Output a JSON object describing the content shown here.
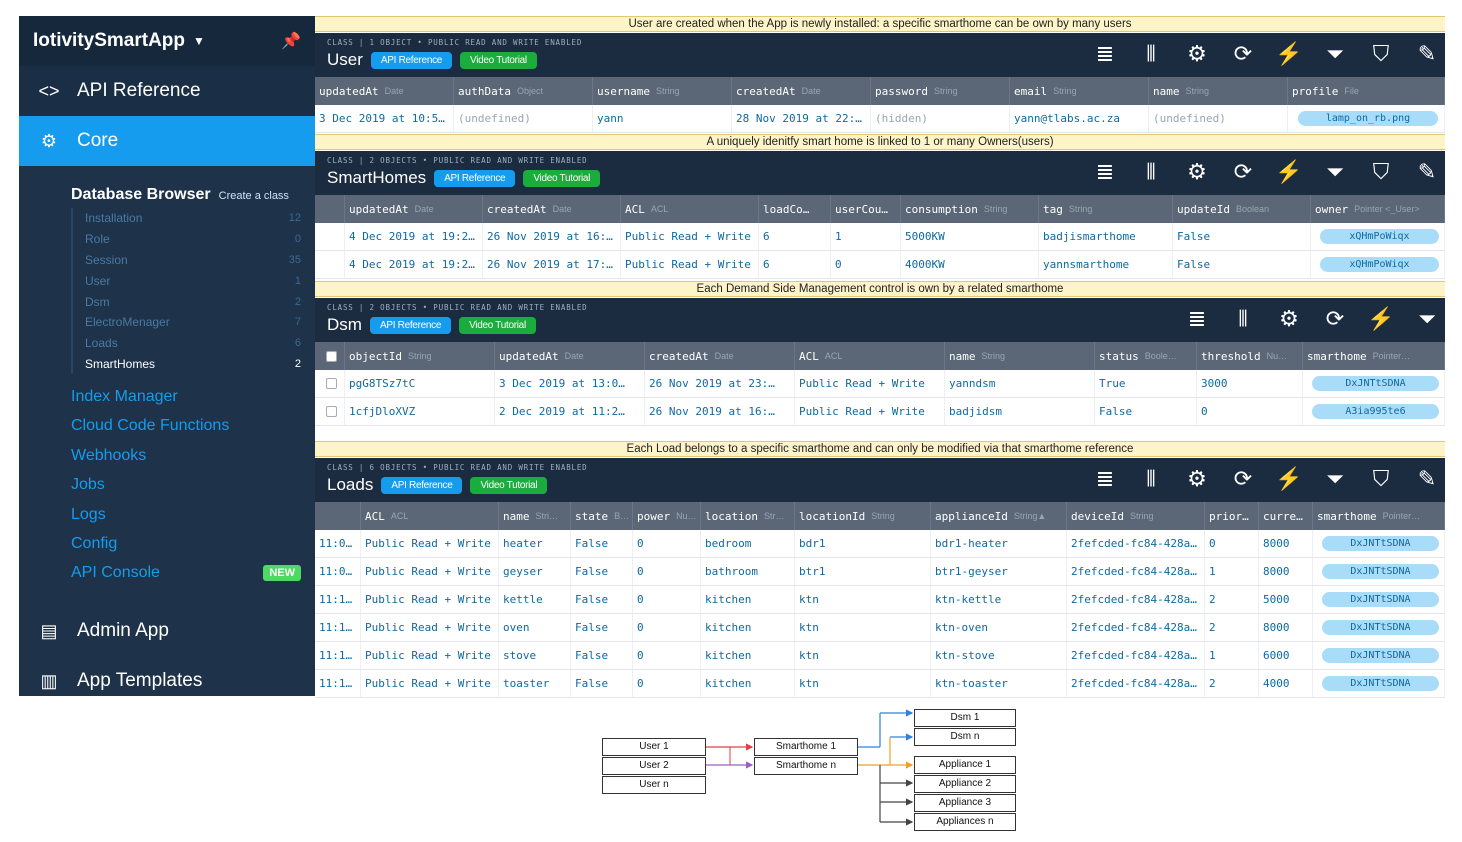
{
  "sidebar": {
    "app_name": "IotivitySmartApp",
    "api_reference": "API Reference",
    "core": "Core",
    "database_browser": "Database Browser",
    "create_class": "Create a class",
    "classes": [
      {
        "name": "Installation",
        "count": "12"
      },
      {
        "name": "Role",
        "count": "0"
      },
      {
        "name": "Session",
        "count": "35"
      },
      {
        "name": "User",
        "count": "1"
      },
      {
        "name": "Dsm",
        "count": "2"
      },
      {
        "name": "ElectroMenager",
        "count": "7"
      },
      {
        "name": "Loads",
        "count": "6"
      },
      {
        "name": "SmartHomes",
        "count": "2"
      }
    ],
    "links": [
      {
        "label": "Index Manager"
      },
      {
        "label": "Cloud Code Functions"
      },
      {
        "label": "Webhooks"
      },
      {
        "label": "Jobs"
      },
      {
        "label": "Logs"
      },
      {
        "label": "Config"
      },
      {
        "label": "API Console",
        "badge": "NEW"
      }
    ],
    "admin_app": "Admin App",
    "app_templates": "App Templates"
  },
  "notes": {
    "user": "User are created when the App is newly installed: a specific smarthome can be own by many users",
    "smarthomes": "A uniquely idenitfy smart home is linked to 1 or many Owners(users)",
    "dsm": "Each Demand Side Management control is own by a related smarthome",
    "loads": "Each Load  belongs to a specific smarthome and can only be modified via that smarthome reference"
  },
  "buttons": {
    "api": "API Reference",
    "video": "Video Tutorial"
  },
  "panels": {
    "user": {
      "meta": "CLASS | 1 OBJECT • PUBLIC READ AND WRITE ENABLED",
      "title": "User",
      "columns": [
        {
          "name": "updatedAt",
          "type": "Date"
        },
        {
          "name": "authData",
          "type": "Object"
        },
        {
          "name": "username",
          "type": "String"
        },
        {
          "name": "createdAt",
          "type": "Date"
        },
        {
          "name": "password",
          "type": "String"
        },
        {
          "name": "email",
          "type": "String"
        },
        {
          "name": "name",
          "type": "String"
        },
        {
          "name": "profile",
          "type": "File"
        }
      ],
      "rows": [
        [
          "3 Dec 2019 at 10:5…",
          "(undefined)",
          "yann",
          "28 Nov 2019 at 22:…",
          "(hidden)",
          "yann@tlabs.ac.za",
          "(undefined)",
          "lamp_on_rb.png"
        ]
      ]
    },
    "smarthomes": {
      "meta": "CLASS | 2 OBJECTS • PUBLIC READ AND WRITE ENABLED",
      "title": "SmartHomes",
      "columns": [
        {
          "name": "updatedAt",
          "type": "Date"
        },
        {
          "name": "createdAt",
          "type": "Date"
        },
        {
          "name": "ACL",
          "type": "ACL"
        },
        {
          "name": "loadCo…",
          "type": ""
        },
        {
          "name": "userCou…",
          "type": ""
        },
        {
          "name": "consumption",
          "type": "String"
        },
        {
          "name": "tag",
          "type": "String"
        },
        {
          "name": "updateId",
          "type": "Boolean"
        },
        {
          "name": "owner",
          "type": "Pointer <_User>"
        }
      ],
      "rows": [
        [
          "4 Dec 2019 at 19:2…",
          "26 Nov 2019 at 16:…",
          "Public Read + Write",
          "6",
          "1",
          "5000KW",
          "badjismarthome",
          "False",
          "xQHmPoWiqx"
        ],
        [
          "4 Dec 2019 at 19:2…",
          "26 Nov 2019 at 17:…",
          "Public Read + Write",
          "6",
          "0",
          "4000KW",
          "yannsmarthome",
          "False",
          "xQHmPoWiqx"
        ]
      ]
    },
    "dsm": {
      "meta": "CLASS | 2 OBJECTS • PUBLIC READ AND WRITE ENABLED",
      "title": "Dsm",
      "columns": [
        {
          "name": "objectId",
          "type": "String"
        },
        {
          "name": "updatedAt",
          "type": "Date"
        },
        {
          "name": "createdAt",
          "type": "Date"
        },
        {
          "name": "ACL",
          "type": "ACL"
        },
        {
          "name": "name",
          "type": "String"
        },
        {
          "name": "status",
          "type": "Boole…"
        },
        {
          "name": "threshold",
          "type": "Nu…"
        },
        {
          "name": "smarthome",
          "type": "Pointer…"
        }
      ],
      "rows": [
        [
          "pgG8TSz7tC",
          "3 Dec 2019 at 13:0…",
          "26 Nov 2019 at 23:…",
          "Public Read + Write",
          "yanndsm",
          "True",
          "3000",
          "DxJNTtSDNA"
        ],
        [
          "1cfjDloXVZ",
          "2 Dec 2019 at 11:2…",
          "26 Nov 2019 at 16:…",
          "Public Read + Write",
          "badjidsm",
          "False",
          "0",
          "A3ia995te6"
        ]
      ]
    },
    "loads": {
      "meta": "CLASS | 6 OBJECTS • PUBLIC READ AND WRITE ENABLED",
      "title": "Loads",
      "columns": [
        {
          "name": "",
          "type": ""
        },
        {
          "name": "ACL",
          "type": "ACL"
        },
        {
          "name": "name",
          "type": "Stri…"
        },
        {
          "name": "state",
          "type": "B…"
        },
        {
          "name": "power",
          "type": "Nu…"
        },
        {
          "name": "location",
          "type": "Str…"
        },
        {
          "name": "locationId",
          "type": "String"
        },
        {
          "name": "applianceId",
          "type": "String▲"
        },
        {
          "name": "deviceId",
          "type": "String"
        },
        {
          "name": "prior…",
          "type": ""
        },
        {
          "name": "curre…",
          "type": ""
        },
        {
          "name": "smarthome",
          "type": "Pointer…"
        }
      ],
      "rows": [
        [
          "11:0…",
          "Public Read + Write",
          "heater",
          "False",
          "0",
          "bedroom",
          "bdr1",
          "bdr1-heater",
          "2fefcded-fc84-428a…",
          "0",
          "8000",
          "DxJNTtSDNA"
        ],
        [
          "11:0…",
          "Public Read + Write",
          "geyser",
          "False",
          "0",
          "bathroom",
          "btr1",
          "btr1-geyser",
          "2fefcded-fc84-428a…",
          "1",
          "8000",
          "DxJNTtSDNA"
        ],
        [
          "11:1…",
          "Public Read + Write",
          "kettle",
          "False",
          "0",
          "kitchen",
          "ktn",
          "ktn-kettle",
          "2fefcded-fc84-428a…",
          "2",
          "5000",
          "DxJNTtSDNA"
        ],
        [
          "11:1…",
          "Public Read + Write",
          "oven",
          "False",
          "0",
          "kitchen",
          "ktn",
          "ktn-oven",
          "2fefcded-fc84-428a…",
          "2",
          "8000",
          "DxJNTtSDNA"
        ],
        [
          "11:1…",
          "Public Read + Write",
          "stove",
          "False",
          "0",
          "kitchen",
          "ktn",
          "ktn-stove",
          "2fefcded-fc84-428a…",
          "1",
          "6000",
          "DxJNTtSDNA"
        ],
        [
          "11:1…",
          "Public Read + Write",
          "toaster",
          "False",
          "0",
          "kitchen",
          "ktn",
          "ktn-toaster",
          "2fefcded-fc84-428a…",
          "2",
          "4000",
          "DxJNTtSDNA"
        ]
      ]
    }
  },
  "diagram": {
    "users": [
      "User 1",
      "User 2",
      "User n"
    ],
    "smarthomes": [
      "Smarthome 1",
      "Smarthome n"
    ],
    "dsms": [
      "Dsm 1",
      "Dsm n"
    ],
    "appliances": [
      "Appliance 1",
      "Appliance 2",
      "Appliance 3",
      "Appliances n"
    ]
  }
}
